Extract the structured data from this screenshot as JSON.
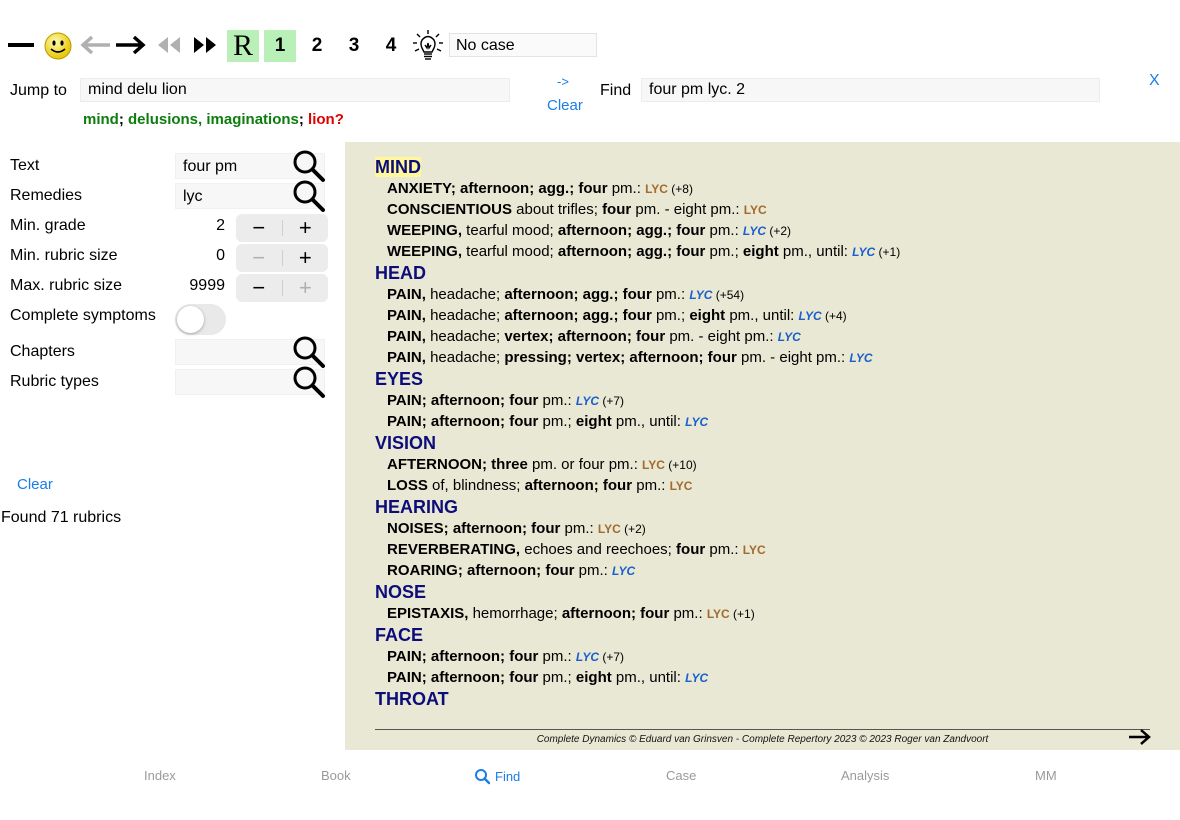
{
  "toolbar": {
    "case_field": "No case",
    "r_label": "R",
    "grade_buttons": [
      "1",
      "2",
      "3",
      "4"
    ]
  },
  "jump": {
    "label": "Jump to",
    "value": "mind delu lion",
    "arrow": "->",
    "clear": "Clear"
  },
  "find": {
    "label": "Find",
    "value": "four pm lyc. 2",
    "close": "X"
  },
  "suggest": {
    "part1": "mind",
    "sep1": "; ",
    "part2": "delusions, imaginations",
    "sep2": "; ",
    "part3": "lion?"
  },
  "form": {
    "text_label": "Text",
    "text_value": "four pm",
    "remedies_label": "Remedies",
    "remedies_value": "lyc",
    "min_grade_label": "Min. grade",
    "min_grade_value": "2",
    "min_size_label": "Min. rubric size",
    "min_size_value": "0",
    "max_size_label": "Max. rubric size",
    "max_size_value": "9999",
    "complete_label": "Complete symptoms",
    "chapters_label": "Chapters",
    "rubric_types_label": "Rubric types",
    "clear": "Clear",
    "found": "Found 71 rubrics"
  },
  "results": [
    {
      "chapter": "MIND",
      "rubrics": [
        {
          "parts": [
            [
              "b",
              "ANXIETY; afternoon; agg.; four"
            ],
            [
              "n",
              " pm.: "
            ]
          ],
          "rem": "LYC",
          "style": "brown",
          "count": " (+8)"
        },
        {
          "parts": [
            [
              "b",
              "CONSCIENTIOUS"
            ],
            [
              "n",
              " about trifles; "
            ],
            [
              "b",
              "four"
            ],
            [
              "n",
              " pm. - eight pm.: "
            ]
          ],
          "rem": "LYC",
          "style": "brown",
          "count": ""
        },
        {
          "parts": [
            [
              "b",
              "WEEPING,"
            ],
            [
              "n",
              " tearful mood; "
            ],
            [
              "b",
              "afternoon; agg.; four"
            ],
            [
              "n",
              " pm.: "
            ]
          ],
          "rem": "LYC",
          "style": "blue",
          "count": " (+2)"
        },
        {
          "parts": [
            [
              "b",
              "WEEPING,"
            ],
            [
              "n",
              " tearful mood; "
            ],
            [
              "b",
              "afternoon; agg.; four"
            ],
            [
              "n",
              " pm.; "
            ],
            [
              "b",
              "eight"
            ],
            [
              "n",
              " pm., until: "
            ]
          ],
          "rem": "LYC",
          "style": "blue",
          "count": " (+1)"
        }
      ]
    },
    {
      "chapter": "HEAD",
      "rubrics": [
        {
          "parts": [
            [
              "b",
              "PAIN,"
            ],
            [
              "n",
              " headache; "
            ],
            [
              "b",
              "afternoon; agg.; four"
            ],
            [
              "n",
              " pm.: "
            ]
          ],
          "rem": "LYC",
          "style": "blue",
          "count": " (+54)"
        },
        {
          "parts": [
            [
              "b",
              "PAIN,"
            ],
            [
              "n",
              " headache; "
            ],
            [
              "b",
              "afternoon; agg.; four"
            ],
            [
              "n",
              " pm.; "
            ],
            [
              "b",
              "eight"
            ],
            [
              "n",
              " pm., until: "
            ]
          ],
          "rem": "LYC",
          "style": "blue",
          "count": " (+4)"
        },
        {
          "parts": [
            [
              "b",
              "PAIN,"
            ],
            [
              "n",
              " headache; "
            ],
            [
              "b",
              "vertex; afternoon; four"
            ],
            [
              "n",
              " pm. - eight pm.: "
            ]
          ],
          "rem": "LYC",
          "style": "blue",
          "count": ""
        },
        {
          "parts": [
            [
              "b",
              "PAIN,"
            ],
            [
              "n",
              " headache; "
            ],
            [
              "b",
              "pressing; vertex; afternoon; four"
            ],
            [
              "n",
              " pm. - eight pm.: "
            ]
          ],
          "rem": "LYC",
          "style": "blue",
          "count": ""
        }
      ]
    },
    {
      "chapter": "EYES",
      "rubrics": [
        {
          "parts": [
            [
              "b",
              "PAIN; afternoon; four"
            ],
            [
              "n",
              " pm.: "
            ]
          ],
          "rem": "LYC",
          "style": "blue",
          "count": " (+7)"
        },
        {
          "parts": [
            [
              "b",
              "PAIN; afternoon; four"
            ],
            [
              "n",
              " pm.; "
            ],
            [
              "b",
              "eight"
            ],
            [
              "n",
              " pm., until: "
            ]
          ],
          "rem": "LYC",
          "style": "blue",
          "count": ""
        }
      ]
    },
    {
      "chapter": "VISION",
      "rubrics": [
        {
          "parts": [
            [
              "b",
              "AFTERNOON; three"
            ],
            [
              "n",
              " pm. or four pm.: "
            ]
          ],
          "rem": "LYC",
          "style": "brown",
          "count": " (+10)"
        },
        {
          "parts": [
            [
              "b",
              "LOSS"
            ],
            [
              "n",
              " of, blindness; "
            ],
            [
              "b",
              "afternoon; four"
            ],
            [
              "n",
              " pm.: "
            ]
          ],
          "rem": "LYC",
          "style": "brown",
          "count": ""
        }
      ]
    },
    {
      "chapter": "HEARING",
      "rubrics": [
        {
          "parts": [
            [
              "b",
              "NOISES; afternoon; four"
            ],
            [
              "n",
              " pm.: "
            ]
          ],
          "rem": "LYC",
          "style": "brown",
          "count": " (+2)"
        },
        {
          "parts": [
            [
              "b",
              "REVERBERATING,"
            ],
            [
              "n",
              " echoes and reechoes; "
            ],
            [
              "b",
              "four"
            ],
            [
              "n",
              " pm.: "
            ]
          ],
          "rem": "LYC",
          "style": "brown",
          "count": ""
        },
        {
          "parts": [
            [
              "b",
              "ROARING; afternoon; four"
            ],
            [
              "n",
              " pm.: "
            ]
          ],
          "rem": "LYC",
          "style": "blue",
          "count": ""
        }
      ]
    },
    {
      "chapter": "NOSE",
      "rubrics": [
        {
          "parts": [
            [
              "b",
              "EPISTAXIS,"
            ],
            [
              "n",
              " hemorrhage; "
            ],
            [
              "b",
              "afternoon; four"
            ],
            [
              "n",
              " pm.: "
            ]
          ],
          "rem": "LYC",
          "style": "brown",
          "count": " (+1)"
        }
      ]
    },
    {
      "chapter": "FACE",
      "rubrics": [
        {
          "parts": [
            [
              "b",
              "PAIN; afternoon; four"
            ],
            [
              "n",
              " pm.: "
            ]
          ],
          "rem": "LYC",
          "style": "blue",
          "count": " (+7)"
        },
        {
          "parts": [
            [
              "b",
              "PAIN; afternoon; four"
            ],
            [
              "n",
              " pm.; "
            ],
            [
              "b",
              "eight"
            ],
            [
              "n",
              " pm., until: "
            ]
          ],
          "rem": "LYC",
          "style": "blue",
          "count": ""
        }
      ]
    },
    {
      "chapter": "THROAT",
      "rubrics": []
    }
  ],
  "footer": "Complete Dynamics © Eduard van Grinsven   -   Complete Repertory 2023 © 2023 Roger van Zandvoort",
  "tabs": [
    "Index",
    "Book",
    "Find",
    "Case",
    "Analysis",
    "MM"
  ],
  "colors": {
    "panel_bg": "#e9e8d4",
    "chapter": "#0d0d7a",
    "accent": "#1a7ee6",
    "grade_highlight": "#b8f0b8"
  }
}
